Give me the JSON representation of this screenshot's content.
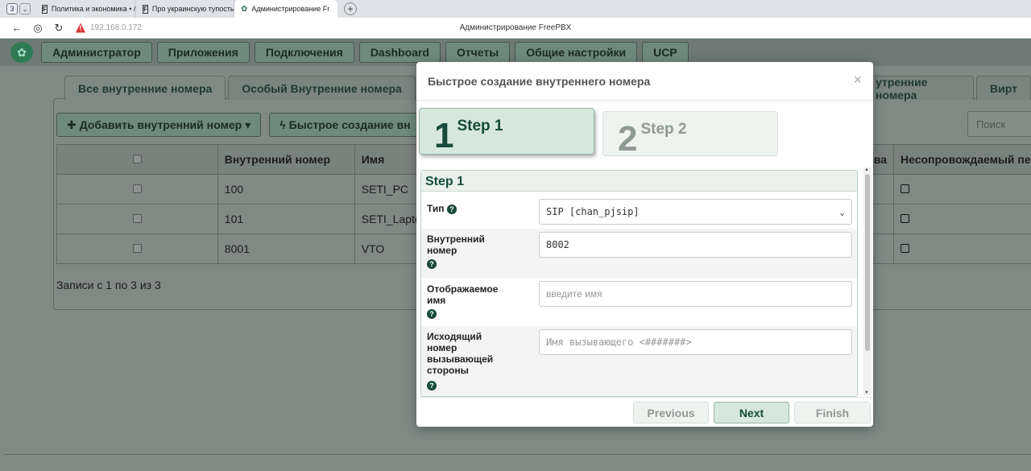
{
  "browser": {
    "workspace_badge": "3",
    "tabs": [
      {
        "label": "Политика и экономика • /",
        "favicon": "F"
      },
      {
        "label": "Про украинскую тупость",
        "favicon": "F"
      },
      {
        "label": "Администрирование Fr",
        "favicon": "frog"
      }
    ],
    "url": "192.168.0.172",
    "page_title": "Администрирование FreePBX"
  },
  "app_nav": {
    "items": [
      "Администратор",
      "Приложения",
      "Подключения",
      "Dashboard",
      "Отчеты",
      "Общие настройки",
      "UCP"
    ]
  },
  "page": {
    "tabs": [
      "Все внутренние номера",
      "Особый Внутренние номера"
    ],
    "tabs_right": [
      "утренние номера",
      "Вирт"
    ],
    "toolbar": {
      "add_label": "Добавить внутренний номер",
      "quick_label": "Быстрое создание вн"
    },
    "search_placeholder": "Поиск",
    "table": {
      "headers": [
        "Внутренний номер",
        "Имя",
        "ва",
        "Несопровождаемый пе"
      ],
      "rows": [
        {
          "number": "100",
          "name": "SETI_PC"
        },
        {
          "number": "101",
          "name": "SETI_Laptop"
        },
        {
          "number": "8001",
          "name": "VTO"
        }
      ]
    },
    "records_text": "Записи с 1 по 3 из 3"
  },
  "modal": {
    "title": "Быстрое создание внутреннего номера",
    "close": "×",
    "steps": [
      {
        "num": "1",
        "label": "Step 1",
        "active": true
      },
      {
        "num": "2",
        "label": "Step 2",
        "active": false
      }
    ],
    "section_title": "Step 1",
    "fields": {
      "type_label": "Тип",
      "type_value": "SIP [chan_pjsip]",
      "ext_label": "Внутренний номер",
      "ext_value": "8002",
      "display_label": "Отображаемое имя",
      "display_placeholder": "введите имя",
      "outbound_label": "Исходящий номер вызывающей стороны",
      "outbound_placeholder": "Имя вызывающего <#######>"
    },
    "buttons": {
      "previous": "Previous",
      "next": "Next",
      "finish": "Finish"
    }
  },
  "colors": {
    "accent": "#174a3a",
    "step_active_bg": "#d6e7dd",
    "backdrop": "#7f8a85"
  }
}
